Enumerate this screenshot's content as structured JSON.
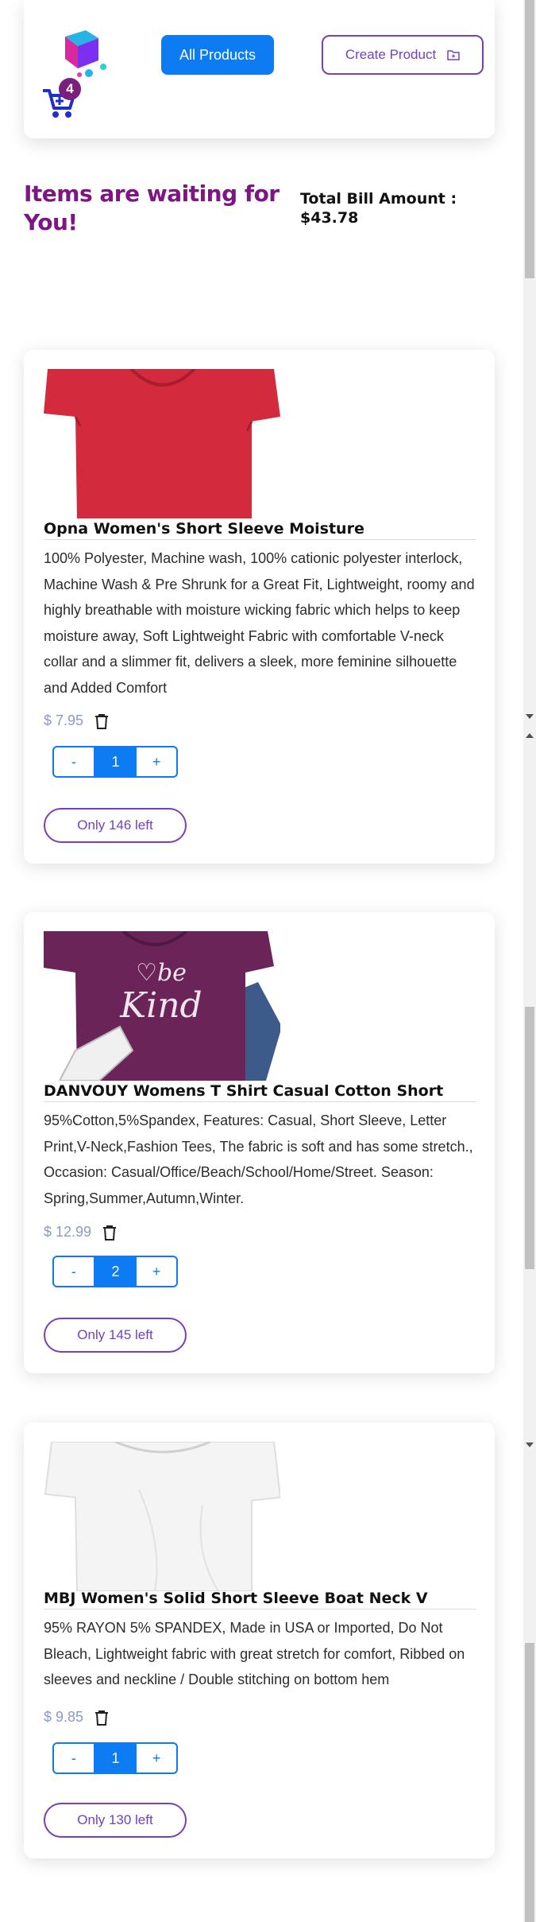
{
  "header": {
    "cart_count": "4",
    "all_products_label": "All Products",
    "create_product_label": "Create Product"
  },
  "summary": {
    "heading": "Items are waiting for You!",
    "bill_label": "Total Bill Amount :",
    "bill_value": "$43.78"
  },
  "products": [
    {
      "title": "Opna Women's Short Sleeve Moisture",
      "description": "100% Polyester, Machine wash, 100% cationic polyester interlock, Machine Wash & Pre Shrunk for a Great Fit, Lightweight, roomy and highly breathable with moisture wicking fabric which helps to keep moisture away, Soft Lightweight Fabric with comfortable V-neck collar and a slimmer fit, delivers a sleek, more feminine silhouette and Added Comfort",
      "price": "$ 7.95",
      "qty_minus": "-",
      "quantity": "1",
      "qty_plus": "+",
      "stock": "Only 146 left",
      "color": "#d42a3e"
    },
    {
      "title": "DANVOUY Womens T Shirt Casual Cotton Short",
      "description": "95%Cotton,5%Spandex, Features: Casual, Short Sleeve, Letter Print,V-Neck,Fashion Tees, The fabric is soft and has some stretch., Occasion: Casual/Office/Beach/School/Home/Street. Season: Spring,Summer,Autumn,Winter.",
      "price": "$ 12.99",
      "qty_minus": "-",
      "quantity": "2",
      "qty_plus": "+",
      "stock": "Only 145 left",
      "color": "#6a2458"
    },
    {
      "title": "MBJ Women's Solid Short Sleeve Boat Neck V",
      "description": "95% RAYON 5% SPANDEX, Made in USA or Imported, Do Not Bleach, Lightweight fabric with great stretch for comfort, Ribbed on sleeves and neckline / Double stitching on bottom hem",
      "price": "$ 9.85",
      "qty_minus": "-",
      "quantity": "1",
      "qty_plus": "+",
      "stock": "Only 130 left",
      "color": "#f4f4f4"
    }
  ]
}
